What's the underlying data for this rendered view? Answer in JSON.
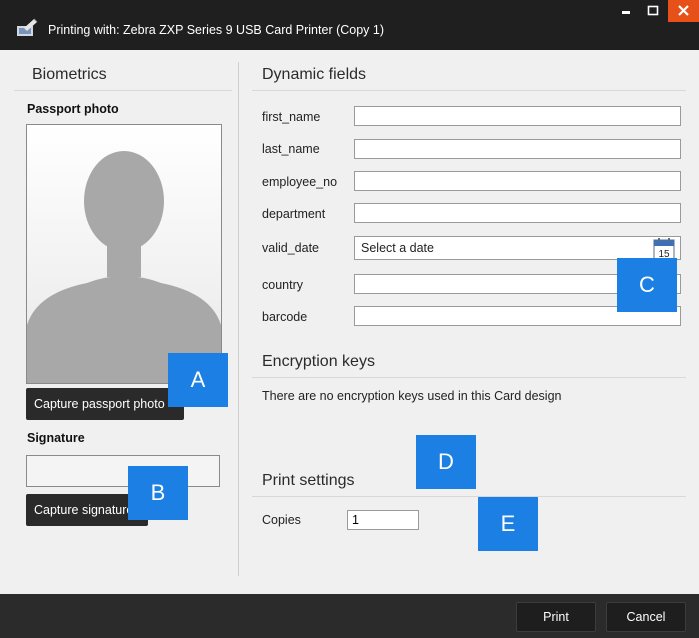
{
  "window": {
    "title": "Printing with: Zebra ZXP Series 9 USB Card Printer (Copy 1)",
    "controls": [
      "minimize",
      "maximize",
      "close"
    ],
    "close_color": "#e8501a"
  },
  "biometrics": {
    "heading": "Biometrics",
    "passport_label": "Passport photo",
    "capture_photo_button": "Capture passport photo",
    "signature_label": "Signature",
    "capture_signature_button": "Capture signature"
  },
  "dynamic_fields": {
    "heading": "Dynamic fields",
    "fields": [
      {
        "label": "first_name",
        "value": ""
      },
      {
        "label": "last_name",
        "value": ""
      },
      {
        "label": "employee_no",
        "value": ""
      },
      {
        "label": "department",
        "value": ""
      },
      {
        "label": "valid_date",
        "value": "",
        "placeholder": "Select a date"
      },
      {
        "label": "country",
        "value": ""
      },
      {
        "label": "barcode",
        "value": ""
      }
    ],
    "calendar_day": "15"
  },
  "encryption": {
    "heading": "Encryption keys",
    "message": "There are no encryption keys used in this Card design"
  },
  "print_settings": {
    "heading": "Print settings",
    "copies_label": "Copies",
    "copies_value": "1"
  },
  "callouts": [
    "A",
    "B",
    "C",
    "D",
    "E"
  ],
  "callout_color": "#1b7fe3",
  "footer": {
    "print_button": "Print",
    "cancel_button": "Cancel"
  }
}
